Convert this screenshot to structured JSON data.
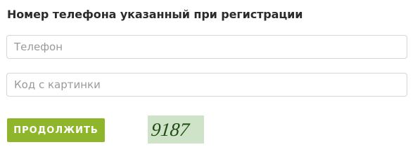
{
  "form": {
    "heading": "Номер телефона указанный при регистрации",
    "phone_placeholder": "Телефон",
    "phone_value": "",
    "captcha_placeholder": "Код с картинки",
    "captcha_value": "",
    "continue_label": "ПРОДОЛЖИТЬ"
  },
  "captcha": {
    "text": "9187",
    "background_color": "#cfe3c9",
    "text_color": "#1f4a12"
  },
  "colors": {
    "accent": "#8fb62b",
    "heading": "#2b2b2b",
    "input_border": "#d6d6d6"
  }
}
